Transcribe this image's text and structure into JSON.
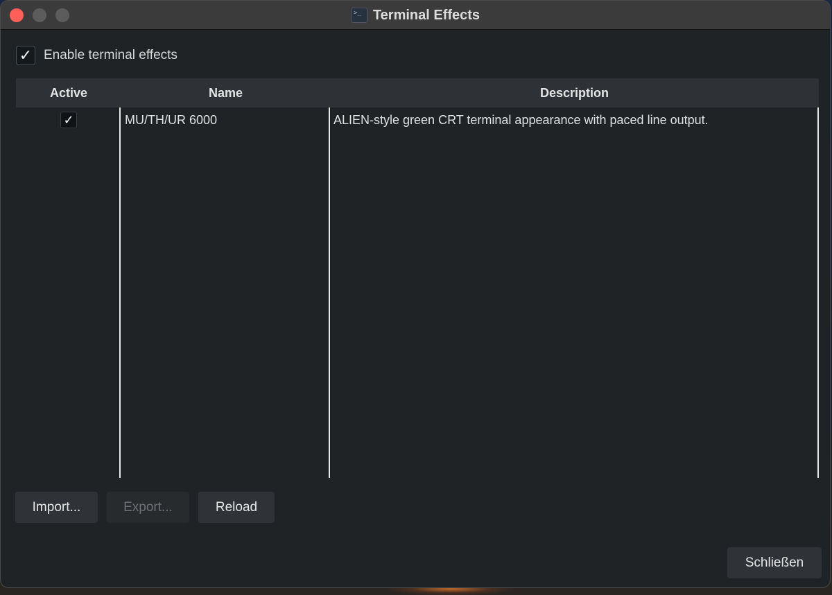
{
  "window": {
    "title": "Terminal Effects",
    "app_icon": "terminal-icon"
  },
  "enable": {
    "label": "Enable terminal effects",
    "checked": true
  },
  "table": {
    "columns": [
      "Active",
      "Name",
      "Description"
    ],
    "rows": [
      {
        "active": true,
        "check_glyph": "✓",
        "name": "MU/TH/UR 6000",
        "description": "ALIEN-style green CRT terminal appearance with paced line output."
      }
    ]
  },
  "buttons": {
    "import": "Import...",
    "export": "Export...",
    "reload": "Reload",
    "close": "Schließen"
  },
  "colors": {
    "close_button": "#ff5f57",
    "window_bg": "#1f2326",
    "header_bg": "#2e3236"
  }
}
